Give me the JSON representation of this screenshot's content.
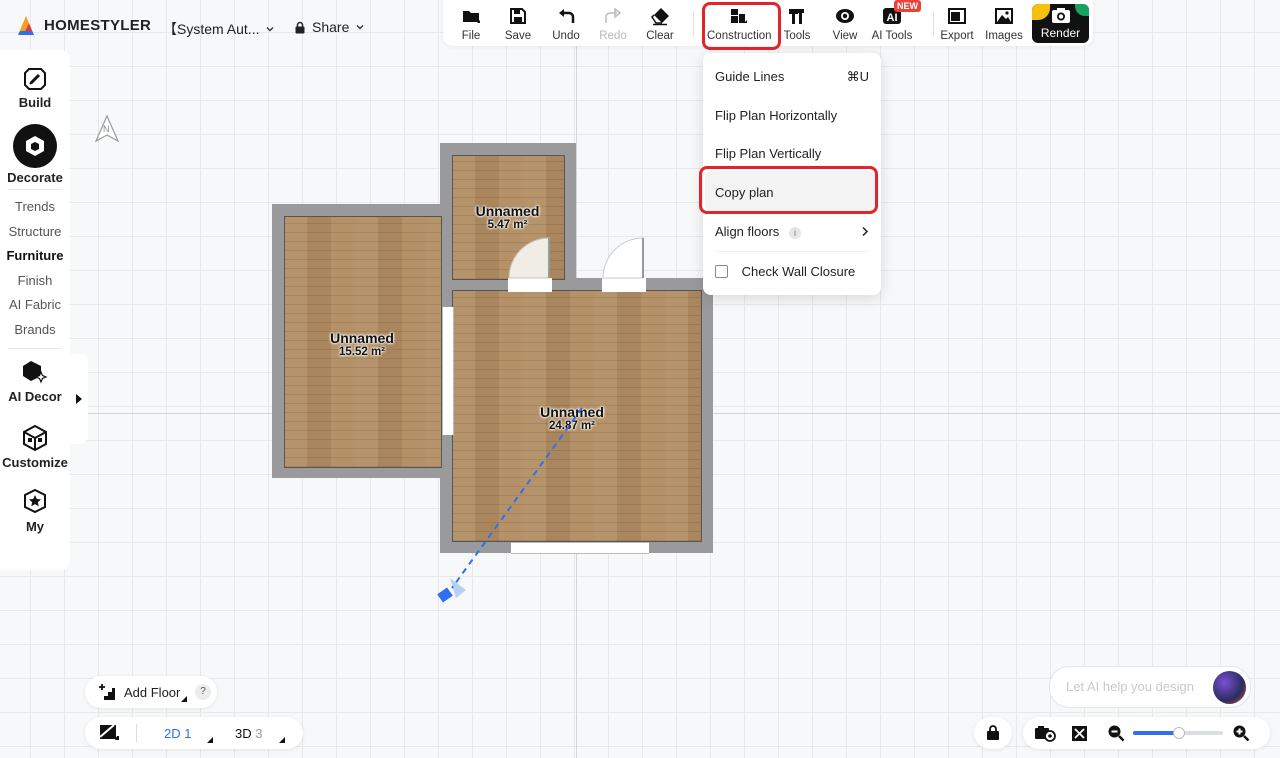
{
  "app": {
    "brand": "HOMESTYLER",
    "doc_title": "【System Aut...",
    "share_label": "Share"
  },
  "toolbar": {
    "file": "File",
    "save": "Save",
    "undo": "Undo",
    "redo": "Redo",
    "clear": "Clear",
    "construction": "Construction",
    "tools": "Tools",
    "view": "View",
    "ai_tools": "AI Tools",
    "ai_tools_badge": "NEW",
    "export": "Export",
    "images": "Images",
    "render": "Render"
  },
  "sidebar": {
    "build": "Build",
    "decorate": "Decorate",
    "sub_items": [
      "Trends",
      "Structure",
      "Furniture",
      "Finish",
      "AI Fabric",
      "Brands"
    ],
    "active_sub": "Furniture",
    "ai_decor": "AI Decor",
    "customize": "Customize",
    "my": "My"
  },
  "compass": "N",
  "rooms": [
    {
      "name": "Unnamed",
      "area": "5.47 m²"
    },
    {
      "name": "Unnamed",
      "area": "15.52 m²"
    },
    {
      "name": "Unnamed",
      "area": "24.87 m²"
    }
  ],
  "construction_menu": {
    "guide_lines": "Guide Lines",
    "guide_lines_shortcut": "⌘U",
    "flip_horizontal": "Flip Plan Horizontally",
    "flip_vertical": "Flip Plan Vertically",
    "copy_plan": "Copy plan",
    "align_floors": "Align floors",
    "check_wall_closure": "Check Wall Closure",
    "check_wall_closure_checked": false
  },
  "bottom": {
    "add_floor": "Add Floor",
    "help": "?",
    "view_2d": "2D",
    "floor_2d": "1",
    "view_3d": "3D",
    "floor_3d": "3",
    "ai_placeholder": "Let AI help you design",
    "zoom_level": 0.5
  },
  "colors": {
    "accent": "#2f6ff0",
    "highlight": "#e0262b",
    "wall": "#9a9a9c",
    "floor": "#b28d62"
  }
}
